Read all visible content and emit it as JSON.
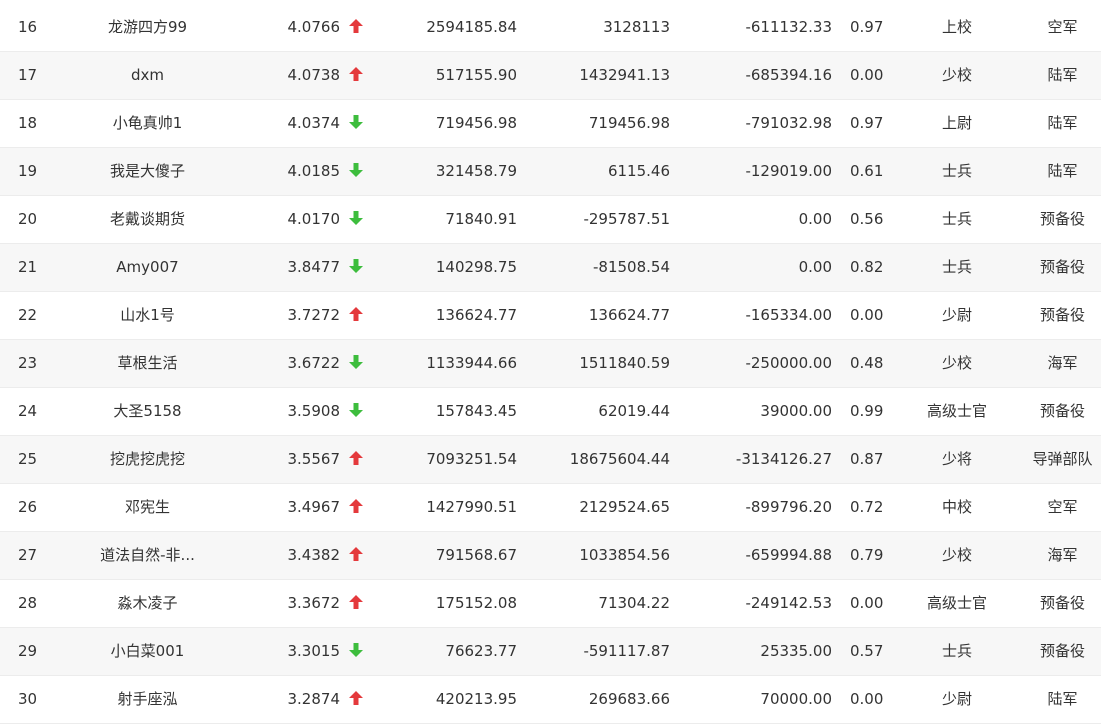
{
  "colors": {
    "up": "#e4393c",
    "down": "#3dbd3d"
  },
  "rows": [
    {
      "rank": "16",
      "name": "龙游四方99",
      "score": "4.0766",
      "trend": "up",
      "v1": "2594185.84",
      "v2": "3128113",
      "v3": "-611132.33",
      "ratio": "0.97",
      "title": "上校",
      "branch": "空军"
    },
    {
      "rank": "17",
      "name": "dxm",
      "score": "4.0738",
      "trend": "up",
      "v1": "517155.90",
      "v2": "1432941.13",
      "v3": "-685394.16",
      "ratio": "0.00",
      "title": "少校",
      "branch": "陆军"
    },
    {
      "rank": "18",
      "name": "小龟真帅1",
      "score": "4.0374",
      "trend": "down",
      "v1": "719456.98",
      "v2": "719456.98",
      "v3": "-791032.98",
      "ratio": "0.97",
      "title": "上尉",
      "branch": "陆军"
    },
    {
      "rank": "19",
      "name": "我是大傻子",
      "score": "4.0185",
      "trend": "down",
      "v1": "321458.79",
      "v2": "6115.46",
      "v3": "-129019.00",
      "ratio": "0.61",
      "title": "士兵",
      "branch": "陆军"
    },
    {
      "rank": "20",
      "name": "老戴谈期货",
      "score": "4.0170",
      "trend": "down",
      "v1": "71840.91",
      "v2": "-295787.51",
      "v3": "0.00",
      "ratio": "0.56",
      "title": "士兵",
      "branch": "预备役"
    },
    {
      "rank": "21",
      "name": "Amy007",
      "score": "3.8477",
      "trend": "down",
      "v1": "140298.75",
      "v2": "-81508.54",
      "v3": "0.00",
      "ratio": "0.82",
      "title": "士兵",
      "branch": "预备役"
    },
    {
      "rank": "22",
      "name": "山水1号",
      "score": "3.7272",
      "trend": "up",
      "v1": "136624.77",
      "v2": "136624.77",
      "v3": "-165334.00",
      "ratio": "0.00",
      "title": "少尉",
      "branch": "预备役"
    },
    {
      "rank": "23",
      "name": "草根生活",
      "score": "3.6722",
      "trend": "down",
      "v1": "1133944.66",
      "v2": "1511840.59",
      "v3": "-250000.00",
      "ratio": "0.48",
      "title": "少校",
      "branch": "海军"
    },
    {
      "rank": "24",
      "name": "大圣5158",
      "score": "3.5908",
      "trend": "down",
      "v1": "157843.45",
      "v2": "62019.44",
      "v3": "39000.00",
      "ratio": "0.99",
      "title": "高级士官",
      "branch": "预备役"
    },
    {
      "rank": "25",
      "name": "挖虎挖虎挖",
      "score": "3.5567",
      "trend": "up",
      "v1": "7093251.54",
      "v2": "18675604.44",
      "v3": "-3134126.27",
      "ratio": "0.87",
      "title": "少将",
      "branch": "导弹部队"
    },
    {
      "rank": "26",
      "name": "邓宪生",
      "score": "3.4967",
      "trend": "up",
      "v1": "1427990.51",
      "v2": "2129524.65",
      "v3": "-899796.20",
      "ratio": "0.72",
      "title": "中校",
      "branch": "空军"
    },
    {
      "rank": "27",
      "name": "道法自然-非...",
      "score": "3.4382",
      "trend": "up",
      "v1": "791568.67",
      "v2": "1033854.56",
      "v3": "-659994.88",
      "ratio": "0.79",
      "title": "少校",
      "branch": "海军"
    },
    {
      "rank": "28",
      "name": "淼木凌子",
      "score": "3.3672",
      "trend": "up",
      "v1": "175152.08",
      "v2": "71304.22",
      "v3": "-249142.53",
      "ratio": "0.00",
      "title": "高级士官",
      "branch": "预备役"
    },
    {
      "rank": "29",
      "name": "小白菜001",
      "score": "3.3015",
      "trend": "down",
      "v1": "76623.77",
      "v2": "-591117.87",
      "v3": "25335.00",
      "ratio": "0.57",
      "title": "士兵",
      "branch": "预备役"
    },
    {
      "rank": "30",
      "name": "射手座泓",
      "score": "3.2874",
      "trend": "up",
      "v1": "420213.95",
      "v2": "269683.66",
      "v3": "70000.00",
      "ratio": "0.00",
      "title": "少尉",
      "branch": "陆军"
    }
  ]
}
